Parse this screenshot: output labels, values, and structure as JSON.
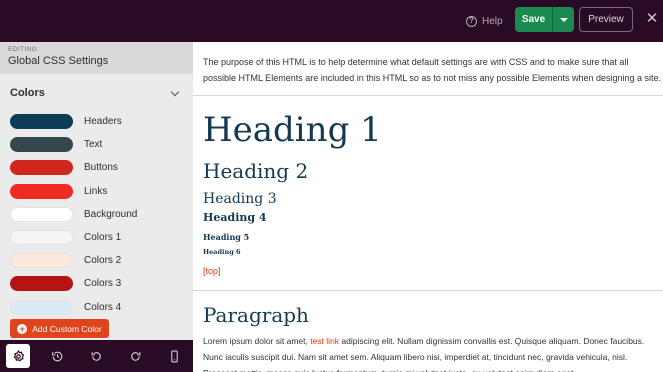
{
  "topbar": {
    "help_label": "Help",
    "help_glyph": "?",
    "save_label": "Save",
    "preview_label": "Preview",
    "close_glyph": "✕"
  },
  "sidebar": {
    "editing_label": "EDITING:",
    "editing_title": "Global CSS Settings",
    "colors_title": "Colors",
    "colors": [
      {
        "label": "Headers",
        "hex": "#0b3d56"
      },
      {
        "label": "Text",
        "hex": "#36464d"
      },
      {
        "label": "Buttons",
        "hex": "#d0261d"
      },
      {
        "label": "Links",
        "hex": "#ef2b22"
      },
      {
        "label": "Background",
        "hex": "#ffffff"
      },
      {
        "label": "Colors 1",
        "hex": "#f5f5f5"
      },
      {
        "label": "Colors 2",
        "hex": "#fde8dd"
      },
      {
        "label": "Colors 3",
        "hex": "#b41414"
      },
      {
        "label": "Colors 4",
        "hex": "#daeaf7"
      }
    ],
    "add_color_label": "Add Custom Color",
    "add_color_glyph": "+"
  },
  "toolbar": {
    "icons": [
      "gear-icon",
      "history-icon",
      "undo-icon",
      "redo-icon",
      "mobile-icon"
    ]
  },
  "content": {
    "intro": "The purpose of this HTML is to help determine what default settings are with CSS and to make sure that all possible HTML Elements are included in this HTML so as to not miss any possible Elements when designing a site.",
    "h1": "Heading 1",
    "h2": "Heading 2",
    "h3": "Heading 3",
    "h4": "Heading 4",
    "h5": "Heading 5",
    "h6": "Heading 6",
    "top_link": "[top]",
    "paragraph_heading": "Paragraph",
    "para_before_link": "Lorem ipsum dolor sit amet, ",
    "para_link": "test link",
    "para_after_link": " adipiscing elit. Nullam dignissim convallis est. Quisque aliquam. Donec faucibus. Nunc iaculis suscipit dui. Nam sit amet sem. Aliquam libero nisi, imperdiet at, tincidunt nec, gravida vehicula, nisl. Praesent mattis, massa quis luctus fermentum, turpis mi volutpat justo, eu volutpat enim diam eget"
  },
  "colors": {
    "topbar_bg": "#2a0b25",
    "save_green": "#1a8a4e",
    "accent_orange": "#e0441c",
    "heading_navy": "#133a52"
  }
}
